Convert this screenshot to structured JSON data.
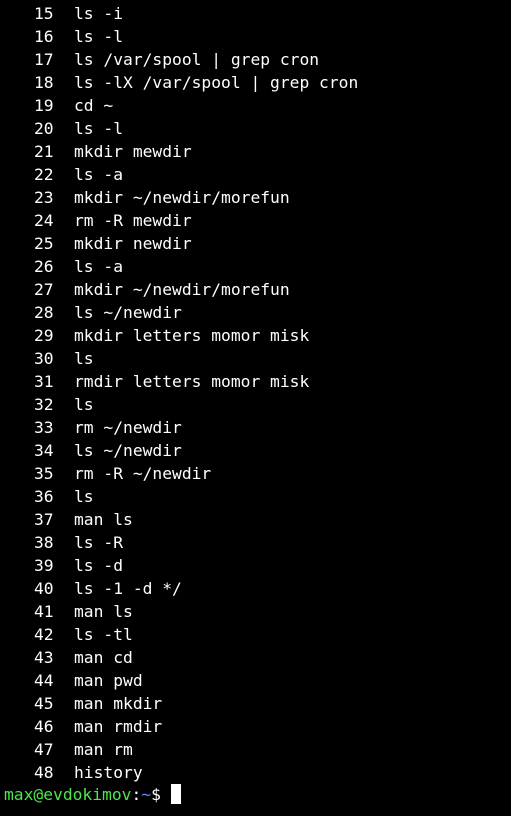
{
  "terminal": {
    "history": [
      {
        "num": "15",
        "cmd": "ls -i"
      },
      {
        "num": "16",
        "cmd": "ls -l"
      },
      {
        "num": "17",
        "cmd": "ls /var/spool | grep cron"
      },
      {
        "num": "18",
        "cmd": "ls -lX /var/spool | grep cron"
      },
      {
        "num": "19",
        "cmd": "cd ~"
      },
      {
        "num": "20",
        "cmd": "ls -l"
      },
      {
        "num": "21",
        "cmd": "mkdir mewdir"
      },
      {
        "num": "22",
        "cmd": "ls -a"
      },
      {
        "num": "23",
        "cmd": "mkdir ~/newdir/morefun"
      },
      {
        "num": "24",
        "cmd": "rm -R mewdir"
      },
      {
        "num": "25",
        "cmd": "mkdir newdir"
      },
      {
        "num": "26",
        "cmd": "ls -a"
      },
      {
        "num": "27",
        "cmd": "mkdir ~/newdir/morefun"
      },
      {
        "num": "28",
        "cmd": "ls ~/newdir"
      },
      {
        "num": "29",
        "cmd": "mkdir letters momor misk"
      },
      {
        "num": "30",
        "cmd": "ls"
      },
      {
        "num": "31",
        "cmd": "rmdir letters momor misk"
      },
      {
        "num": "32",
        "cmd": "ls"
      },
      {
        "num": "33",
        "cmd": "rm ~/newdir"
      },
      {
        "num": "34",
        "cmd": "ls ~/newdir"
      },
      {
        "num": "35",
        "cmd": "rm -R ~/newdir"
      },
      {
        "num": "36",
        "cmd": "ls"
      },
      {
        "num": "37",
        "cmd": "man ls"
      },
      {
        "num": "38",
        "cmd": "ls -R"
      },
      {
        "num": "39",
        "cmd": "ls -d"
      },
      {
        "num": "40",
        "cmd": "ls -1 -d */"
      },
      {
        "num": "41",
        "cmd": "man ls"
      },
      {
        "num": "42",
        "cmd": "ls -tl"
      },
      {
        "num": "43",
        "cmd": "man cd"
      },
      {
        "num": "44",
        "cmd": "man pwd"
      },
      {
        "num": "45",
        "cmd": "man mkdir"
      },
      {
        "num": "46",
        "cmd": "man rmdir"
      },
      {
        "num": "47",
        "cmd": "man rm"
      },
      {
        "num": "48",
        "cmd": "history"
      }
    ],
    "prompt": {
      "user_host": "max@evdokimov",
      "colon": ":",
      "path": "~",
      "symbol": "$"
    },
    "colors": {
      "background": "#000000",
      "text": "#ffffff",
      "user_host": "#4ce74c",
      "path": "#5c8cff"
    }
  }
}
